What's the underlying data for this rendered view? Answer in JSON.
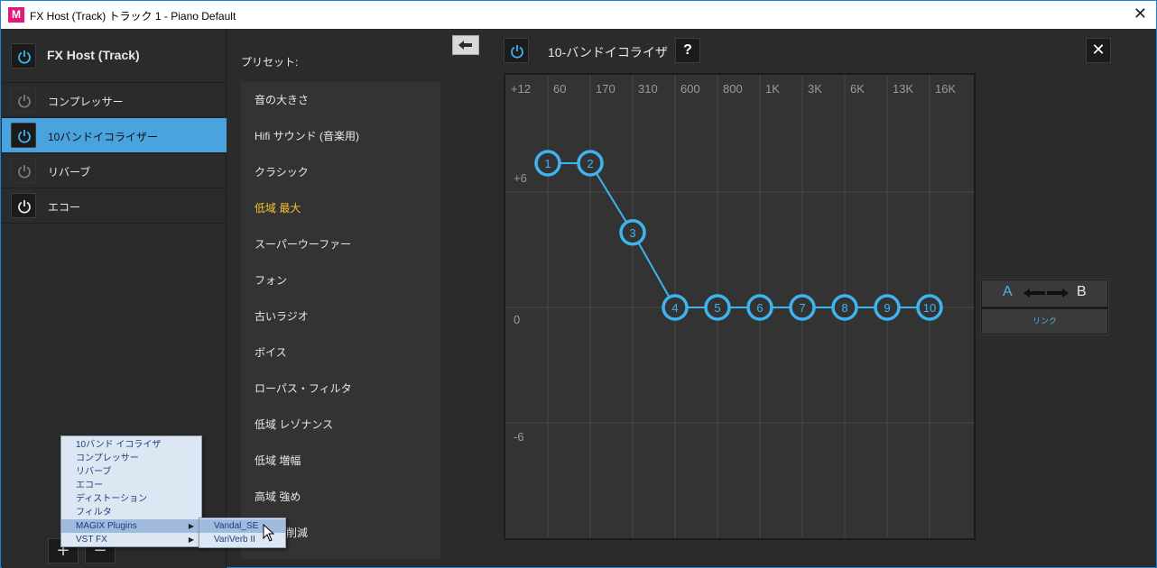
{
  "window": {
    "title": "FX Host (Track) トラック 1 - Piano Default",
    "app_icon": "M",
    "close_glyph": "✕"
  },
  "left_panel": {
    "title": "FX Host (Track)",
    "items": [
      {
        "label": "コンプレッサー",
        "active": false,
        "on": false
      },
      {
        "label": "10バンドイコライザー",
        "active": true,
        "on": true
      },
      {
        "label": "リバーブ",
        "active": false,
        "on": false
      },
      {
        "label": "エコー",
        "active": false,
        "on": true
      }
    ],
    "add_label": "+",
    "remove_label": "−"
  },
  "context_menu": {
    "items": [
      {
        "label": "10バンド イコライザ",
        "has_submenu": false,
        "highlighted": false
      },
      {
        "label": "コンプレッサー",
        "has_submenu": false,
        "highlighted": false
      },
      {
        "label": "リバーブ",
        "has_submenu": false,
        "highlighted": false
      },
      {
        "label": "エコー",
        "has_submenu": false,
        "highlighted": false
      },
      {
        "label": "ディストーション",
        "has_submenu": false,
        "highlighted": false
      },
      {
        "label": "フィルタ",
        "has_submenu": false,
        "highlighted": false
      },
      {
        "label": "MAGIX Plugins",
        "has_submenu": true,
        "highlighted": true
      },
      {
        "label": "VST FX",
        "has_submenu": true,
        "highlighted": false
      }
    ],
    "submenu": [
      {
        "label": "Vandal_SE",
        "highlighted": true
      },
      {
        "label": "VariVerb II",
        "highlighted": false
      }
    ]
  },
  "presets": {
    "heading": "プリセット:",
    "items": [
      {
        "label": "音の大きさ"
      },
      {
        "label": "Hifi サウンド (音楽用)"
      },
      {
        "label": "クラシック"
      },
      {
        "label": "低域 最大",
        "selected": true
      },
      {
        "label": "スーパーウーファー"
      },
      {
        "label": "フォン"
      },
      {
        "label": "古いラジオ"
      },
      {
        "label": "ボイス"
      },
      {
        "label": "ローパス・フィルタ"
      },
      {
        "label": "低域 レゾナンス"
      },
      {
        "label": "低域 増幅"
      },
      {
        "label": "高域 強め"
      },
      {
        "label": "削減",
        "visible_text": "削減"
      }
    ]
  },
  "equalizer": {
    "title": "10-バンドイコライザ",
    "help_label": "?",
    "close_label": "✕",
    "freq_labels": [
      "+12",
      "60",
      "170",
      "310",
      "600",
      "800",
      "1K",
      "3K",
      "6K",
      "13K",
      "16K"
    ],
    "db_labels": {
      "plus6": "+6",
      "zero": "0",
      "minus6": "-6"
    },
    "bands": [
      {
        "label": "1",
        "gain_db": 7.5
      },
      {
        "label": "2",
        "gain_db": 7.5
      },
      {
        "label": "3",
        "gain_db": 3.9
      },
      {
        "label": "4",
        "gain_db": 0
      },
      {
        "label": "5",
        "gain_db": 0
      },
      {
        "label": "6",
        "gain_db": 0
      },
      {
        "label": "7",
        "gain_db": 0
      },
      {
        "label": "8",
        "gain_db": 0
      },
      {
        "label": "9",
        "gain_db": 0
      },
      {
        "label": "10",
        "gain_db": 0
      }
    ],
    "colors": {
      "accent": "#3eb4ee",
      "background": "#333333",
      "grid": "#4a4a4a"
    }
  },
  "ab_compare": {
    "a_label": "A",
    "b_label": "B",
    "link_label": "リンク"
  }
}
